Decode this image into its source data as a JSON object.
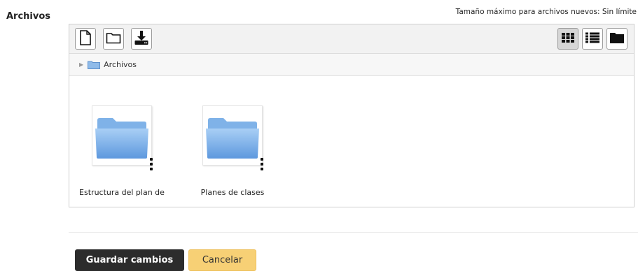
{
  "form": {
    "field_label": "Archivos",
    "max_size_text": "Tamaño máximo para archivos nuevos: Sin límite"
  },
  "filemanager": {
    "toolbar": {
      "left_icons": [
        "new-file-icon",
        "new-folder-icon",
        "download-icon"
      ],
      "right_icons": [
        "grid-view-icon",
        "list-view-icon",
        "tree-view-icon"
      ],
      "active_view": "grid-view-icon"
    },
    "path": {
      "label": "Archivos"
    },
    "items": [
      {
        "name": "Estructura del plan de clases",
        "icon": "folder-icon"
      },
      {
        "name": "Planes de clases",
        "icon": "folder-icon"
      }
    ]
  },
  "actions": {
    "save_label": "Guardar cambios",
    "cancel_label": "Cancelar"
  },
  "colors": {
    "save_bg": "#2c2c2c",
    "cancel_bg": "#f7d075",
    "folder_blue": "#6ea6e6"
  }
}
